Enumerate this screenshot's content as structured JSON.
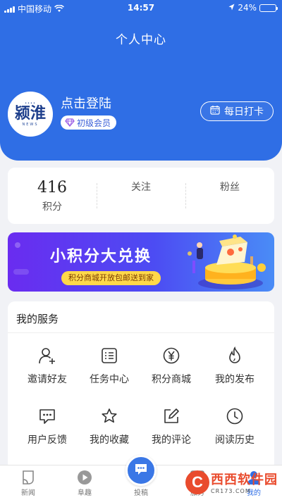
{
  "status_bar": {
    "carrier": "中国移动",
    "time": "14:57",
    "battery_text": "24%",
    "battery_level": 0.24
  },
  "header": {
    "title": "个人中心",
    "avatar_logo": {
      "main": "颍淮",
      "bottom": "NEWS"
    },
    "login_text": "点击登陆",
    "level_badge": "初级会员",
    "checkin_label": "每日打卡"
  },
  "stats": {
    "points_value": "416",
    "points_label": "积分",
    "follow_label": "关注",
    "fans_label": "粉丝"
  },
  "banner": {
    "title": "小积分大兑换",
    "subtitle": "积分商城开放包邮送到家"
  },
  "services": {
    "title": "我的服务",
    "items": [
      {
        "label": "邀请好友",
        "icon": "invite-friend-icon"
      },
      {
        "label": "任务中心",
        "icon": "task-center-icon"
      },
      {
        "label": "积分商城",
        "icon": "yen-icon"
      },
      {
        "label": "我的发布",
        "icon": "flame-icon"
      },
      {
        "label": "用户反馈",
        "icon": "feedback-icon"
      },
      {
        "label": "我的收藏",
        "icon": "star-icon"
      },
      {
        "label": "我的评论",
        "icon": "edit-icon"
      },
      {
        "label": "阅读历史",
        "icon": "clock-icon"
      }
    ]
  },
  "tabbar": {
    "tabs": [
      {
        "label": "新闻",
        "icon": "news-icon"
      },
      {
        "label": "阜趣",
        "icon": "play-icon"
      },
      {
        "label": "投稿",
        "icon": "chat-icon"
      },
      {
        "label": "服务",
        "icon": "service-icon"
      },
      {
        "label": "我的",
        "icon": "profile-icon"
      }
    ],
    "active_tab": "我的"
  },
  "watermark": {
    "logo_letter": "C",
    "name": "西西软件园",
    "url": "CR173.COM"
  },
  "colors": {
    "primary": "#2f6ee5",
    "banner_start": "#6a2cf0",
    "banner_end": "#4a8cf6",
    "banner_badge": "#ffd84a",
    "background": "#f1f2f6"
  }
}
